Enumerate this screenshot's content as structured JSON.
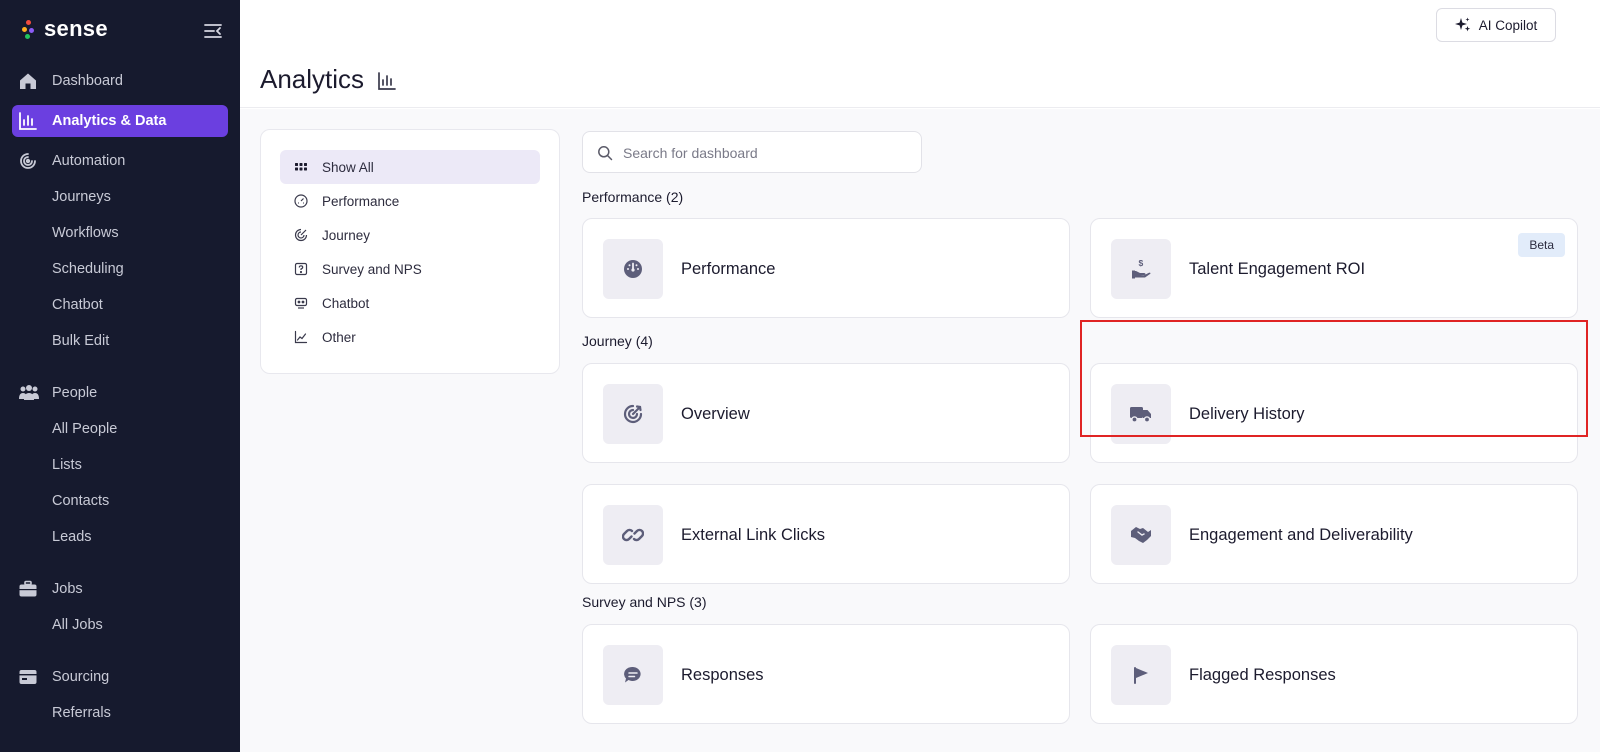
{
  "app": {
    "logo_text": "sense"
  },
  "sidebar": {
    "items": [
      {
        "label": "Dashboard"
      },
      {
        "label": "Analytics & Data"
      },
      {
        "label": "Automation"
      },
      {
        "label": "Journeys"
      },
      {
        "label": "Workflows"
      },
      {
        "label": "Scheduling"
      },
      {
        "label": "Chatbot"
      },
      {
        "label": "Bulk Edit"
      },
      {
        "label": "People"
      },
      {
        "label": "All People"
      },
      {
        "label": "Lists"
      },
      {
        "label": "Contacts"
      },
      {
        "label": "Leads"
      },
      {
        "label": "Jobs"
      },
      {
        "label": "All Jobs"
      },
      {
        "label": "Sourcing"
      },
      {
        "label": "Referrals"
      }
    ]
  },
  "header": {
    "title": "Analytics",
    "copilot_label": "AI Copilot"
  },
  "filters": [
    {
      "label": "Show All"
    },
    {
      "label": "Performance"
    },
    {
      "label": "Journey"
    },
    {
      "label": "Survey and NPS"
    },
    {
      "label": "Chatbot"
    },
    {
      "label": "Other"
    }
  ],
  "search": {
    "placeholder": "Search for dashboard",
    "value": ""
  },
  "sections": [
    {
      "label": "Performance (2)",
      "cards": [
        {
          "title": "Performance",
          "icon": "gauge-icon"
        },
        {
          "title": "Talent Engagement ROI",
          "icon": "hand-dollar-icon",
          "badge": "Beta"
        }
      ]
    },
    {
      "label": "Journey (4)",
      "cards": [
        {
          "title": "Overview",
          "icon": "target-icon"
        },
        {
          "title": "Delivery History",
          "icon": "truck-icon"
        },
        {
          "title": "External Link Clicks",
          "icon": "link-icon"
        },
        {
          "title": "Engagement and Deliverability",
          "icon": "handshake-icon"
        }
      ]
    },
    {
      "label": "Survey and NPS (3)",
      "cards": [
        {
          "title": "Responses",
          "icon": "chat-bubble-icon"
        },
        {
          "title": "Flagged Responses",
          "icon": "flag-icon"
        }
      ]
    }
  ],
  "colors": {
    "sidebar_bg": "#161a2e",
    "accent": "#6b3fe0",
    "highlight": "#e02424",
    "badge_bg": "#e2ecfa",
    "tile_bg": "#eeedf3",
    "icon_color": "#5d5e7a"
  }
}
